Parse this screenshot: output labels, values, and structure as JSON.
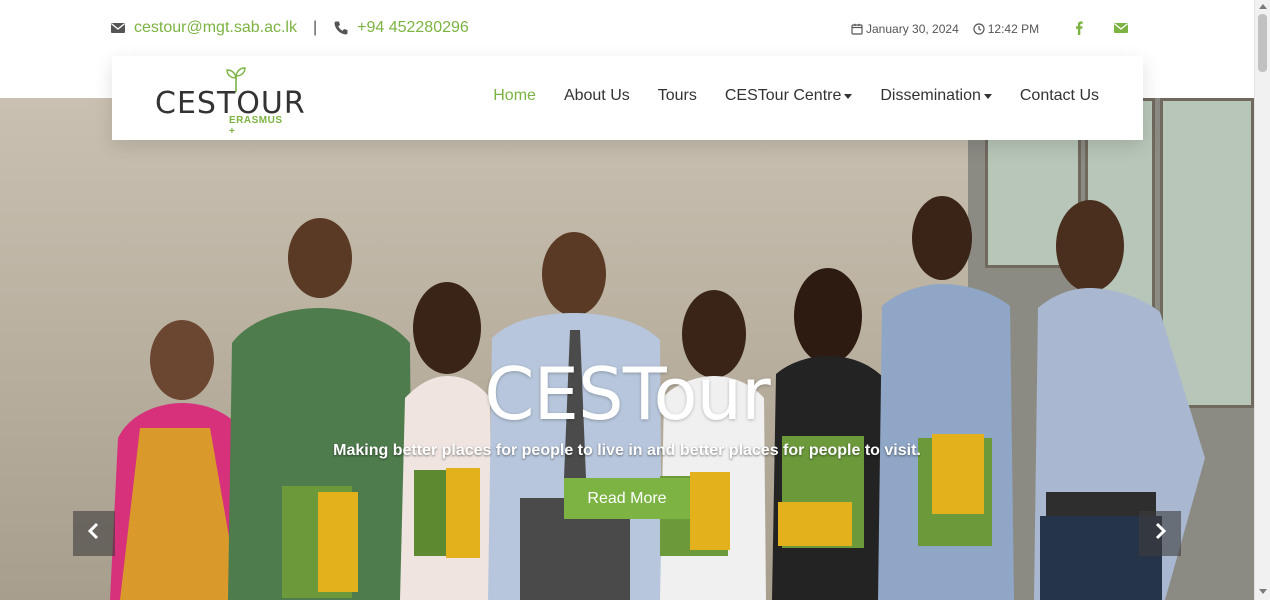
{
  "topbar": {
    "email": "cestour@mgt.sab.ac.lk",
    "separator": "|",
    "phone": "+94 452280296",
    "date": "January 30, 2024",
    "time": "12:42 PM",
    "icons": {
      "email": "envelope-icon",
      "phone": "phone-icon",
      "date": "calendar-icon",
      "time": "clock-icon",
      "facebook": "facebook-icon",
      "mail": "envelope-icon"
    }
  },
  "brand": {
    "name": "CESTOUR",
    "subtitle": "ERASMUS +",
    "accent_color": "#7cb342"
  },
  "nav": {
    "items": [
      {
        "label": "Home",
        "active": true
      },
      {
        "label": "About Us"
      },
      {
        "label": "Tours"
      },
      {
        "label": "CESTour Centre",
        "dropdown": true
      },
      {
        "label": "Dissemination",
        "dropdown": true
      },
      {
        "label": "Contact Us"
      }
    ]
  },
  "hero": {
    "title": "CESTour",
    "subtitle": "Making better places for people to live in and better places for people to visit.",
    "cta_label": "Read More",
    "prev_icon": "chevron-left-icon",
    "next_icon": "chevron-right-icon"
  }
}
